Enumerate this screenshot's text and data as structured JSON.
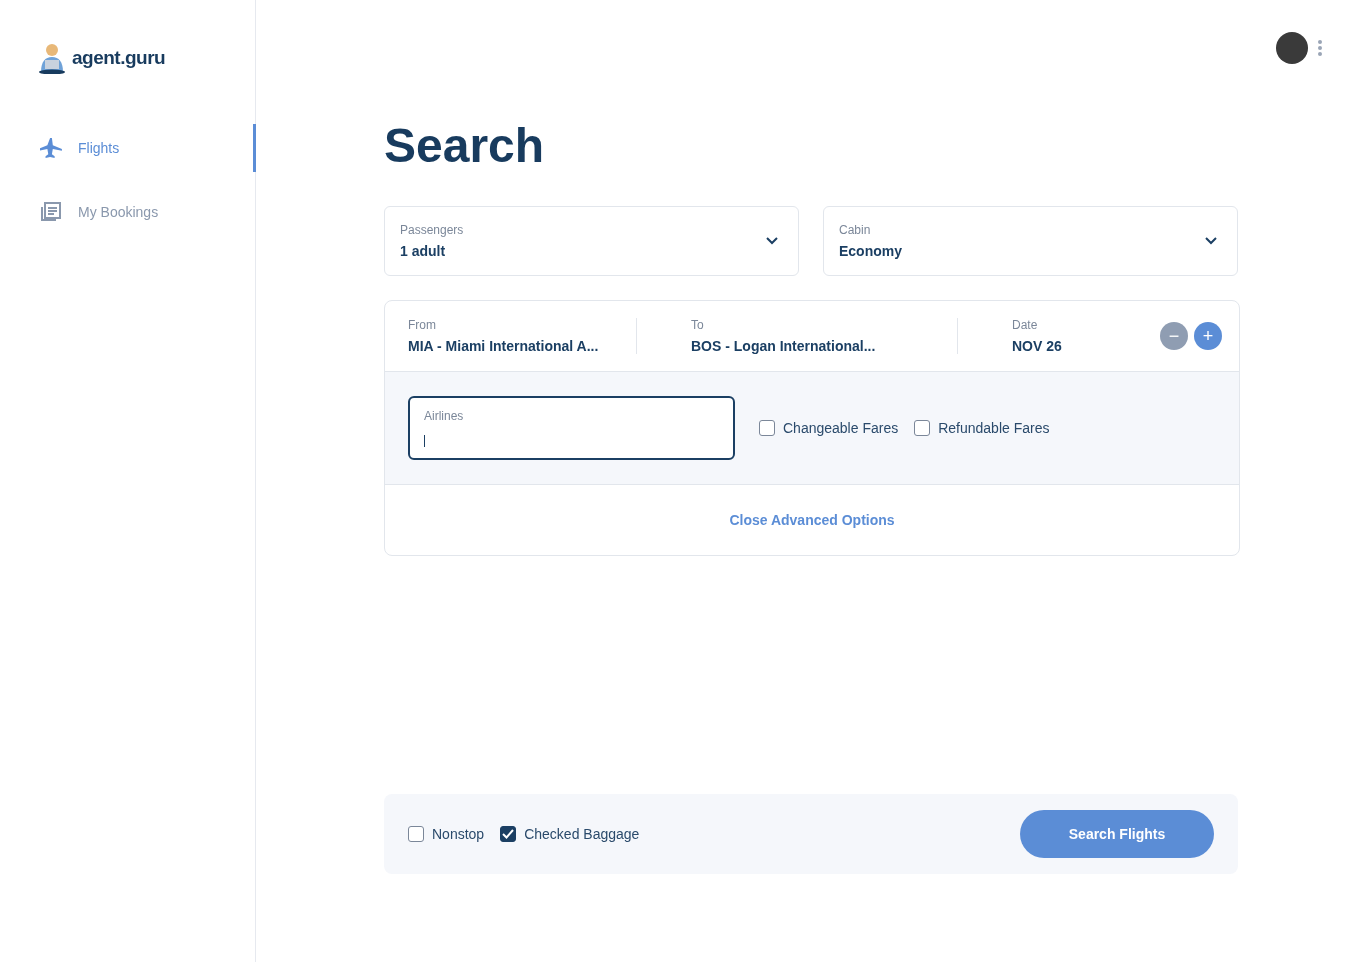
{
  "brand": {
    "name": "agent.guru"
  },
  "sidebar": {
    "items": [
      {
        "label": "Flights",
        "kind": "plane",
        "selected": true
      },
      {
        "label": "My Bookings",
        "kind": "bookings",
        "selected": false
      }
    ]
  },
  "page": {
    "title": "Search"
  },
  "selects": [
    {
      "label": "Passengers",
      "value": "1 adult"
    },
    {
      "label": "Cabin",
      "value": "Economy"
    }
  ],
  "route": {
    "fields": [
      {
        "label": "From",
        "value": "MIA - Miami International A..."
      },
      {
        "label": "To",
        "value": "BOS - Logan International..."
      },
      {
        "label": "Date",
        "value": "NOV 26"
      }
    ],
    "buttons": [
      {
        "symbol": "−",
        "disabled": true
      },
      {
        "symbol": "+",
        "disabled": false
      }
    ]
  },
  "advanced": {
    "airlines": {
      "label": "Airlines",
      "focused": true
    },
    "options": [
      {
        "label": "Changeable Fares",
        "checked": false
      },
      {
        "label": "Refundable Fares",
        "checked": false
      }
    ],
    "toggle_link": "Close Advanced Options"
  },
  "footer": {
    "options": [
      {
        "label": "Nonstop",
        "checked": false
      },
      {
        "label": "Checked Baggage",
        "checked": true
      }
    ],
    "submit": "Search Flights"
  }
}
